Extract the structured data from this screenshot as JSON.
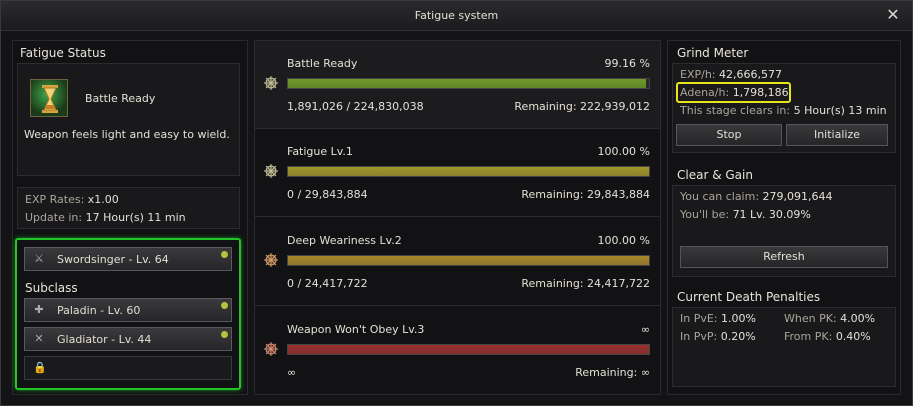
{
  "window": {
    "title": "Fatigue system",
    "close_label": "✕"
  },
  "fatigue_status": {
    "title": "Fatigue Status",
    "state": "Battle Ready",
    "description": "Weapon feels light and easy to wield.",
    "exp_rates_label": "EXP Rates:",
    "exp_rates_value": "x1.00",
    "update_label": "Update in:",
    "update_value": "17 Hour(s) 11 min"
  },
  "characters": {
    "main": {
      "label": "Swordsinger - Lv. 64",
      "icon": "swords-icon"
    },
    "subclass_title": "Subclass",
    "subclasses": [
      {
        "label": "Paladin - Lv. 60",
        "icon": "cross-icon"
      },
      {
        "label": "Gladiator - Lv. 44",
        "icon": "crossed-swords-icon"
      }
    ],
    "locked_slot_icon": "lock-icon"
  },
  "stages": [
    {
      "name": "Battle Ready",
      "percent": "99.16 %",
      "progress": 0.9916,
      "current": "1,891,026 / 224,830,038",
      "remaining": "Remaining: 222,939,012",
      "color": "#6f9a2a"
    },
    {
      "name": "Fatigue Lv.1",
      "percent": "100.00 %",
      "progress": 1.0,
      "current": "0 / 29,843,884",
      "remaining": "Remaining: 29,843,884",
      "color": "#a3972c"
    },
    {
      "name": "Deep Weariness Lv.2",
      "percent": "100.00 %",
      "progress": 1.0,
      "current": "0 / 24,417,722",
      "remaining": "Remaining: 24,417,722",
      "color": "#a8882a"
    },
    {
      "name": "Weapon Won't Obey Lv.3",
      "percent": "∞",
      "progress": 1.0,
      "current": "∞",
      "remaining": "Remaining: ∞",
      "color": "#9a3131"
    }
  ],
  "grind_meter": {
    "title": "Grind Meter",
    "exp_label": "EXP/h:",
    "exp_value": "42,666,577",
    "adena_label": "Adena/h:",
    "adena_value": "1,798,186",
    "clear_label": "This stage clears in:",
    "clear_value": "5 Hour(s) 13 min",
    "stop_label": "Stop",
    "initialize_label": "Initialize"
  },
  "clear_gain": {
    "title": "Clear & Gain",
    "claim_label": "You can claim:",
    "claim_value": "279,091,644",
    "be_label": "You'll be:",
    "be_value": "71 Lv. 30.09%",
    "refresh_label": "Refresh"
  },
  "death_penalties": {
    "title": "Current Death Penalties",
    "pve_label": "In PvE:",
    "pve_value": "1.00%",
    "pvp_label": "In PvP:",
    "pvp_value": "0.20%",
    "when_pk_label": "When PK:",
    "when_pk_value": "4.00%",
    "from_pk_label": "From PK:",
    "from_pk_value": "0.40%"
  },
  "colors": {
    "highlight_green": "#21c52a",
    "highlight_yellow": "#e6e41f"
  }
}
